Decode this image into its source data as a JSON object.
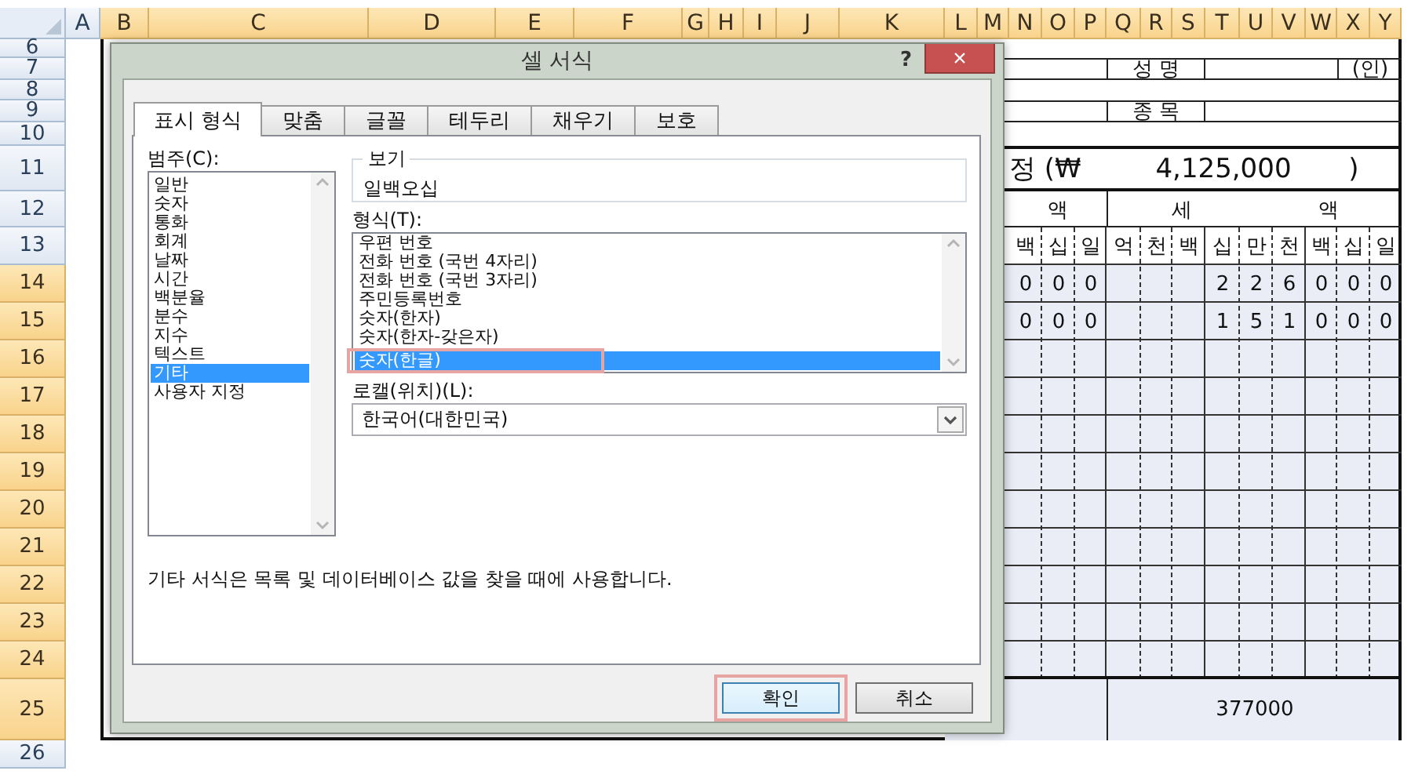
{
  "columns": [
    {
      "label": "A",
      "selected": false
    },
    {
      "label": "B",
      "selected": true
    },
    {
      "label": "C",
      "selected": true
    },
    {
      "label": "D",
      "selected": true
    },
    {
      "label": "E",
      "selected": true
    },
    {
      "label": "F",
      "selected": true
    },
    {
      "label": "G",
      "selected": true
    },
    {
      "label": "H",
      "selected": true
    },
    {
      "label": "I",
      "selected": true
    },
    {
      "label": "J",
      "selected": true
    },
    {
      "label": "K",
      "selected": true
    },
    {
      "label": "L",
      "selected": true
    },
    {
      "label": "M",
      "selected": true
    },
    {
      "label": "N",
      "selected": true
    },
    {
      "label": "O",
      "selected": true
    },
    {
      "label": "P",
      "selected": true
    },
    {
      "label": "Q",
      "selected": true
    },
    {
      "label": "R",
      "selected": true
    },
    {
      "label": "S",
      "selected": true
    },
    {
      "label": "T",
      "selected": true
    },
    {
      "label": "U",
      "selected": true
    },
    {
      "label": "V",
      "selected": true
    },
    {
      "label": "W",
      "selected": true
    },
    {
      "label": "X",
      "selected": true
    },
    {
      "label": "Y",
      "selected": true
    }
  ],
  "rows": [
    {
      "label": "6",
      "selected": false
    },
    {
      "label": "7",
      "selected": false
    },
    {
      "label": "8",
      "selected": false
    },
    {
      "label": "9",
      "selected": false
    },
    {
      "label": "10",
      "selected": false
    },
    {
      "label": "11",
      "selected": false
    },
    {
      "label": "12",
      "selected": false
    },
    {
      "label": "13",
      "selected": false
    },
    {
      "label": "14",
      "selected": true
    },
    {
      "label": "15",
      "selected": true
    },
    {
      "label": "16",
      "selected": true
    },
    {
      "label": "17",
      "selected": true
    },
    {
      "label": "18",
      "selected": true
    },
    {
      "label": "19",
      "selected": true
    },
    {
      "label": "20",
      "selected": true
    },
    {
      "label": "21",
      "selected": true
    },
    {
      "label": "22",
      "selected": true
    },
    {
      "label": "23",
      "selected": true
    },
    {
      "label": "24",
      "selected": true
    },
    {
      "label": "25",
      "selected": true
    },
    {
      "label": "26",
      "selected": false
    }
  ],
  "form": {
    "name_label": "성 명",
    "seal": "(인)",
    "item_label": "종 목",
    "total_prefix": "정 (₩",
    "total_amount": "4,125,000",
    "total_suffix": ")",
    "amount_header": "액",
    "tax_header": [
      "세",
      "액"
    ],
    "digit_headers": [
      "백",
      "십",
      "일",
      "억",
      "천",
      "백",
      "십",
      "만",
      "천",
      "백",
      "십",
      "일"
    ],
    "entries": [
      {
        "amount_digits": [
          "0",
          "0",
          "0"
        ],
        "tax_digits": [
          "2",
          "2",
          "6",
          "0",
          "0",
          "0"
        ]
      },
      {
        "amount_digits": [
          "0",
          "0",
          "0"
        ],
        "tax_digits": [
          "1",
          "5",
          "1",
          "0",
          "0",
          "0"
        ]
      }
    ],
    "sum": "377000"
  },
  "dialog": {
    "title": "셀 서식",
    "help": "?",
    "close": "×",
    "tabs": [
      {
        "label": "표시 형식",
        "selected": true
      },
      {
        "label": "맞춤",
        "selected": false
      },
      {
        "label": "글꼴",
        "selected": false
      },
      {
        "label": "테두리",
        "selected": false
      },
      {
        "label": "채우기",
        "selected": false
      },
      {
        "label": "보호",
        "selected": false
      }
    ],
    "category_label": "범주(C):",
    "categories": [
      {
        "label": "일반",
        "selected": false
      },
      {
        "label": "숫자",
        "selected": false
      },
      {
        "label": "통화",
        "selected": false
      },
      {
        "label": "회계",
        "selected": false
      },
      {
        "label": "날짜",
        "selected": false
      },
      {
        "label": "시간",
        "selected": false
      },
      {
        "label": "백분율",
        "selected": false
      },
      {
        "label": "분수",
        "selected": false
      },
      {
        "label": "지수",
        "selected": false
      },
      {
        "label": "텍스트",
        "selected": false
      },
      {
        "label": "기타",
        "selected": true
      },
      {
        "label": "사용자 지정",
        "selected": false
      }
    ],
    "preview_label": "보기",
    "preview_value": "일백오십",
    "format_label": "형식(T):",
    "formats": [
      {
        "label": "우편 번호",
        "selected": false,
        "highlighted": false
      },
      {
        "label": "전화 번호 (국번 4자리)",
        "selected": false,
        "highlighted": false
      },
      {
        "label": "전화 번호 (국번 3자리)",
        "selected": false,
        "highlighted": false
      },
      {
        "label": "주민등록번호",
        "selected": false,
        "highlighted": false
      },
      {
        "label": "숫자(한자)",
        "selected": false,
        "highlighted": false
      },
      {
        "label": "숫자(한자-갖은자)",
        "selected": false,
        "highlighted": false
      },
      {
        "label": "숫자(한글)",
        "selected": true,
        "highlighted": true
      }
    ],
    "locale_label": "로캘(위치)(L):",
    "locale_value": "한국어(대한민국)",
    "description": "기타 서식은 목록 및 데이터베이스 값을 찾을 때에 사용합니다.",
    "buttons": [
      {
        "label": "확인",
        "highlighted": true
      },
      {
        "label": "취소",
        "highlighted": false
      }
    ]
  }
}
